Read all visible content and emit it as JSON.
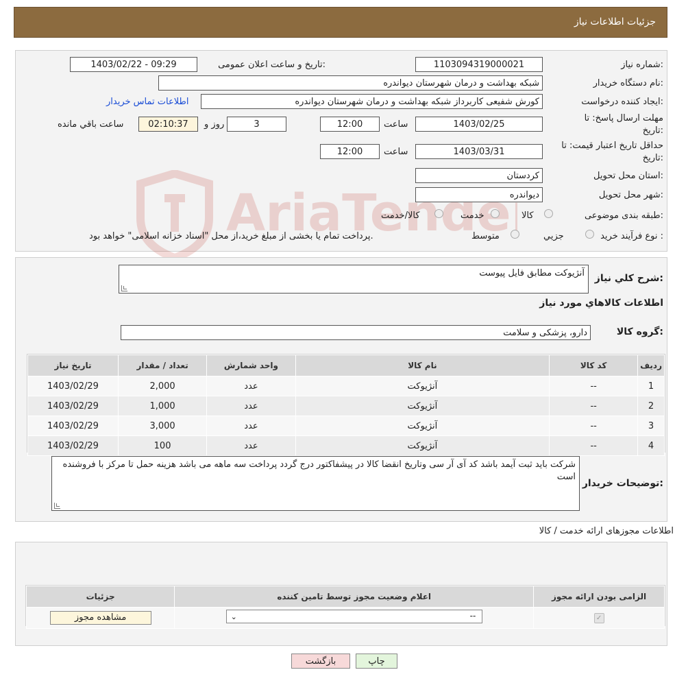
{
  "header": {
    "title": "جزئیات اطلاعات نیاز"
  },
  "info": {
    "need_number_label": "شماره نیاز:",
    "need_number": "1103094319000021",
    "announce_label": "تاریخ و ساعت اعلان عمومی:",
    "announce_value": "1403/02/22 - 09:29",
    "buyer_label": "نام دستگاه خریدار:",
    "buyer_value": "شبکه بهداشت و درمان شهرستان دیواندره",
    "creator_label": "ایجاد کننده درخواست:",
    "creator_value": "کورش شفیعی کاربرداز شبکه بهداشت و درمان شهرستان دیواندره",
    "contact_link": "اطلاعات تماس خریدار",
    "deadline_label": "مهلت ارسال پاسخ: تا تاریخ:",
    "deadline_date": "1403/02/25",
    "time_label": "ساعت",
    "deadline_time": "12:00",
    "days_value": "3",
    "days_label": "روز و",
    "remaining_time": "02:10:37",
    "remaining_label": "ساعت باقي مانده",
    "validity_label": "حداقل تاریخ اعتبار قیمت: تا تاریخ:",
    "validity_date": "1403/03/31",
    "validity_time": "12:00",
    "province_label": "استان محل تحویل:",
    "province_value": "کردستان",
    "city_label": "شهر محل تحویل:",
    "city_value": "دیواندره",
    "category_label": "طبقه بندی موضوعی:",
    "category_options": [
      "کالا",
      "خدمت",
      "کالا/خدمت"
    ],
    "purchase_label": "نوع فرآیند خرید :",
    "purchase_options": [
      "جزيي",
      "متوسط"
    ],
    "purchase_note": "پرداخت تمام يا بخشی از مبلغ خريد،از محل \"اسناد خزانه اسلامی\" خواهد بود."
  },
  "description": {
    "label": "شرح كلي نياز:",
    "value": "آنژیوکت مطابق فایل پیوست",
    "goods_title": "اطلاعات کالاهاي مورد نياز",
    "group_label": "گروه کالا:",
    "group_value": "دارو، پزشکی و سلامت"
  },
  "goods_table": {
    "headers": [
      "رديف",
      "کد کالا",
      "نام کالا",
      "واحد شمارش",
      "تعداد / مقدار",
      "تاریخ نیاز"
    ],
    "rows": [
      [
        "1",
        "--",
        "آنژیوکت",
        "عدد",
        "2,000",
        "1403/02/29"
      ],
      [
        "2",
        "--",
        "آنژیوکت",
        "عدد",
        "1,000",
        "1403/02/29"
      ],
      [
        "3",
        "--",
        "آنژیوکت",
        "عدد",
        "3,000",
        "1403/02/29"
      ],
      [
        "4",
        "--",
        "آنژیوکت",
        "عدد",
        "100",
        "1403/02/29"
      ]
    ]
  },
  "buyer_notes": {
    "label": "توضیحات خریدار:",
    "value": "شرکت باید ثبت آیمد باشد کد آی آر سی وتاریخ انقضا کالا در پیشفاکتور درج گردد  پرداخت سه ماهه می باشد هزینه حمل تا مرکز با فروشنده است"
  },
  "permits": {
    "title": "اطلاعات مجوزهای ارائه خدمت / کالا",
    "headers": [
      "الزامی بودن ارائه مجوز",
      "اعلام وضعیت مجوز توسط تامین کننده",
      "جزئیات"
    ],
    "select_value": "--",
    "view_button": "مشاهده مجوز"
  },
  "actions": {
    "print": "چاپ",
    "back": "بازگشت"
  },
  "watermark": "AriaTender.neT",
  "colors": {
    "header_bg": "#8c6b3f",
    "link": "#1a4dd6",
    "back_btn": "#f7d9d9",
    "print_btn": "#e3f5dc",
    "watermark": "#c0392b"
  }
}
